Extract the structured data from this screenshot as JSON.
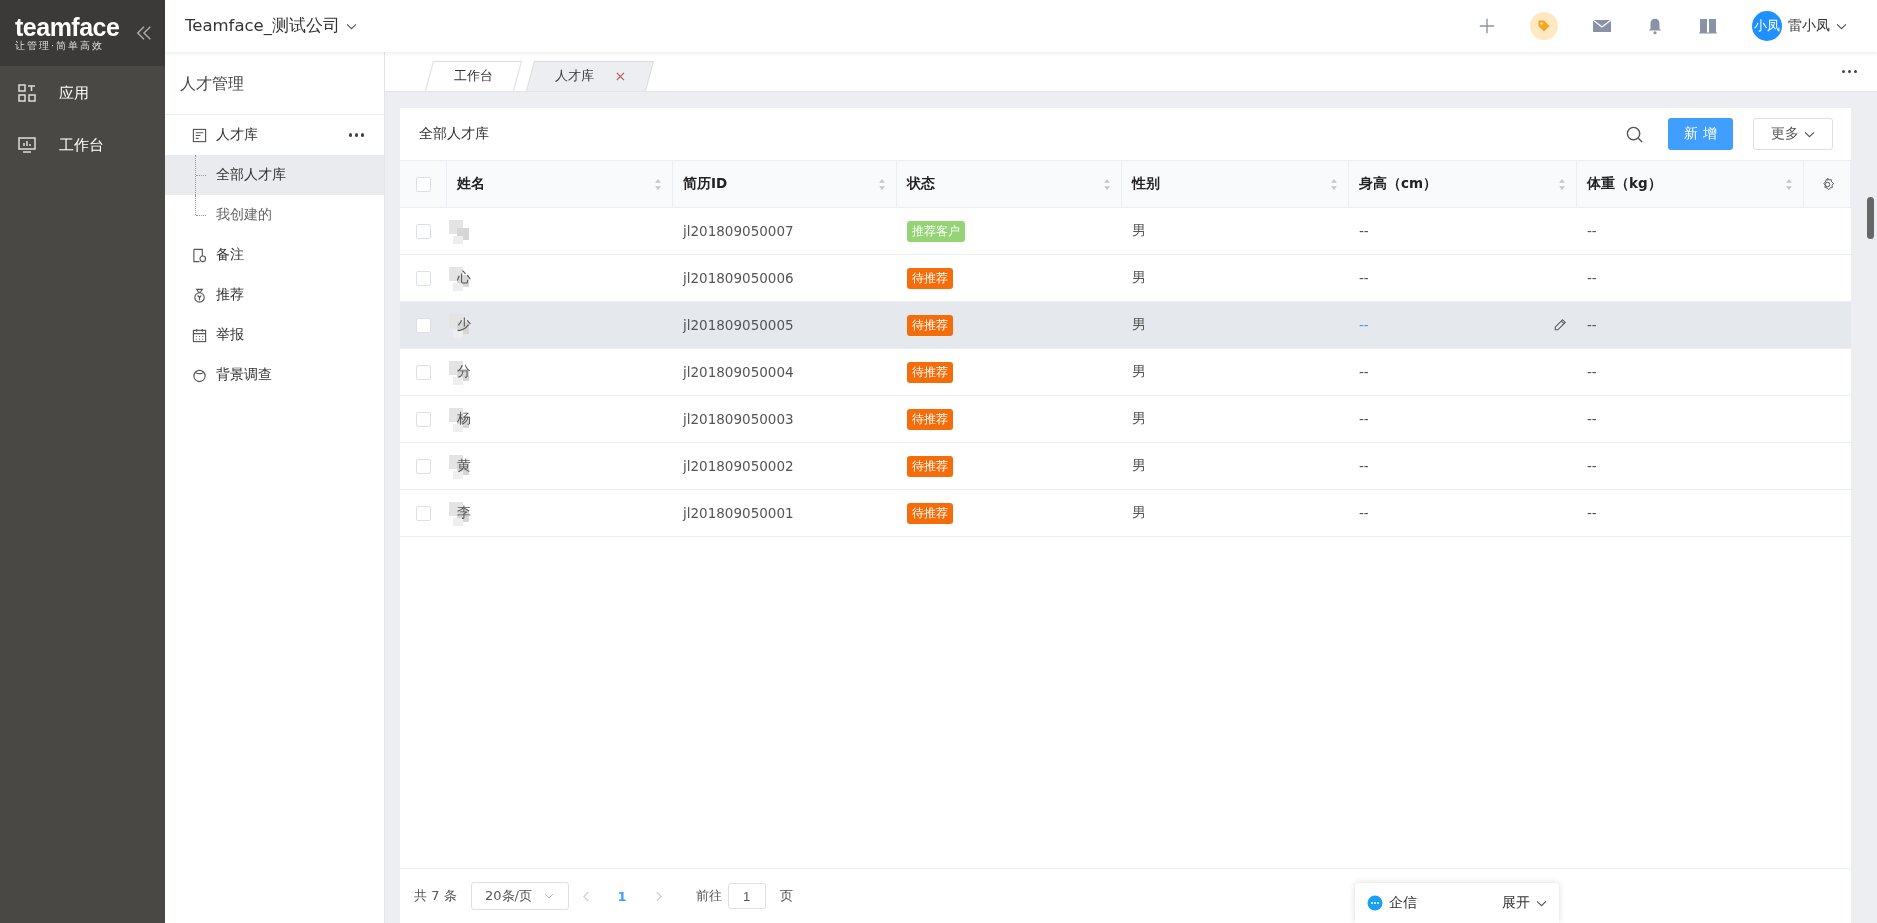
{
  "brand": {
    "logo": "teamface",
    "slogan": "让管理·简单高效"
  },
  "nav": [
    {
      "label": "应用",
      "kind": "apps",
      "selected": false
    },
    {
      "label": "工作台",
      "kind": "dashboard",
      "selected": false
    }
  ],
  "topbar": {
    "company": "Teamface_测试公司",
    "avatar": "小凤",
    "user": "雷小凤"
  },
  "module": {
    "title": "人才管理",
    "items": [
      {
        "label": "人才库",
        "kind": "list",
        "expanded": true,
        "children": [
          {
            "label": "全部人才库",
            "selected": true
          },
          {
            "label": "我创建的",
            "selected": false
          }
        ]
      },
      {
        "label": "备注",
        "kind": "note",
        "expanded": false
      },
      {
        "label": "推荐",
        "kind": "bag",
        "expanded": false
      },
      {
        "label": "举报",
        "kind": "calendar",
        "expanded": false
      },
      {
        "label": "背景调查",
        "kind": "face",
        "expanded": false
      }
    ]
  },
  "tabs": [
    {
      "label": "工作台",
      "selected": false,
      "closable": false
    },
    {
      "label": "人才库",
      "selected": true,
      "closable": true
    }
  ],
  "panel": {
    "title": "全部人才库",
    "add_button": "新 增",
    "more_button": "更多"
  },
  "table": {
    "columns": [
      "姓名",
      "简历ID",
      "状态",
      "性别",
      "身高（cm）",
      "体重（kg）"
    ],
    "all_checked": false,
    "rows": [
      {
        "id": "jl201809050007",
        "status": "推荐客户",
        "color": "#95d475",
        "checked": false,
        "gender": "男",
        "height": "--",
        "weight": "--",
        "highlighted": false
      },
      {
        "name": "心",
        "id": "jl201809050006",
        "status": "待推荐",
        "color": "#f56c0a",
        "checked": false,
        "gender": "男",
        "height": "--",
        "weight": "--",
        "highlighted": false
      },
      {
        "name": "少",
        "id": "jl201809050005",
        "status": "待推荐",
        "color": "#f56c0a",
        "checked": false,
        "gender": "男",
        "height": "--",
        "weight": "--",
        "highlighted": true
      },
      {
        "name": "分",
        "id": "jl201809050004",
        "status": "待推荐",
        "color": "#f56c0a",
        "checked": false,
        "gender": "男",
        "height": "--",
        "weight": "--",
        "highlighted": false
      },
      {
        "name": "杨",
        "id": "jl201809050003",
        "status": "待推荐",
        "color": "#f56c0a",
        "checked": false,
        "gender": "男",
        "height": "--",
        "weight": "--",
        "highlighted": false
      },
      {
        "name": "黄",
        "id": "jl201809050002",
        "status": "待推荐",
        "color": "#f56c0a",
        "checked": false,
        "gender": "男",
        "height": "--",
        "weight": "--",
        "highlighted": false
      },
      {
        "name": "李",
        "id": "jl201809050001",
        "status": "待推荐",
        "color": "#f56c0a",
        "checked": false,
        "gender": "男",
        "height": "--",
        "weight": "--",
        "highlighted": false
      }
    ]
  },
  "pagination": {
    "total": "共 7 条",
    "page_size": "20条/页",
    "current": "1",
    "goto_label": "前往",
    "goto_value": "1",
    "page_unit": "页"
  },
  "chat": {
    "label": "企信",
    "expand": "展开"
  }
}
